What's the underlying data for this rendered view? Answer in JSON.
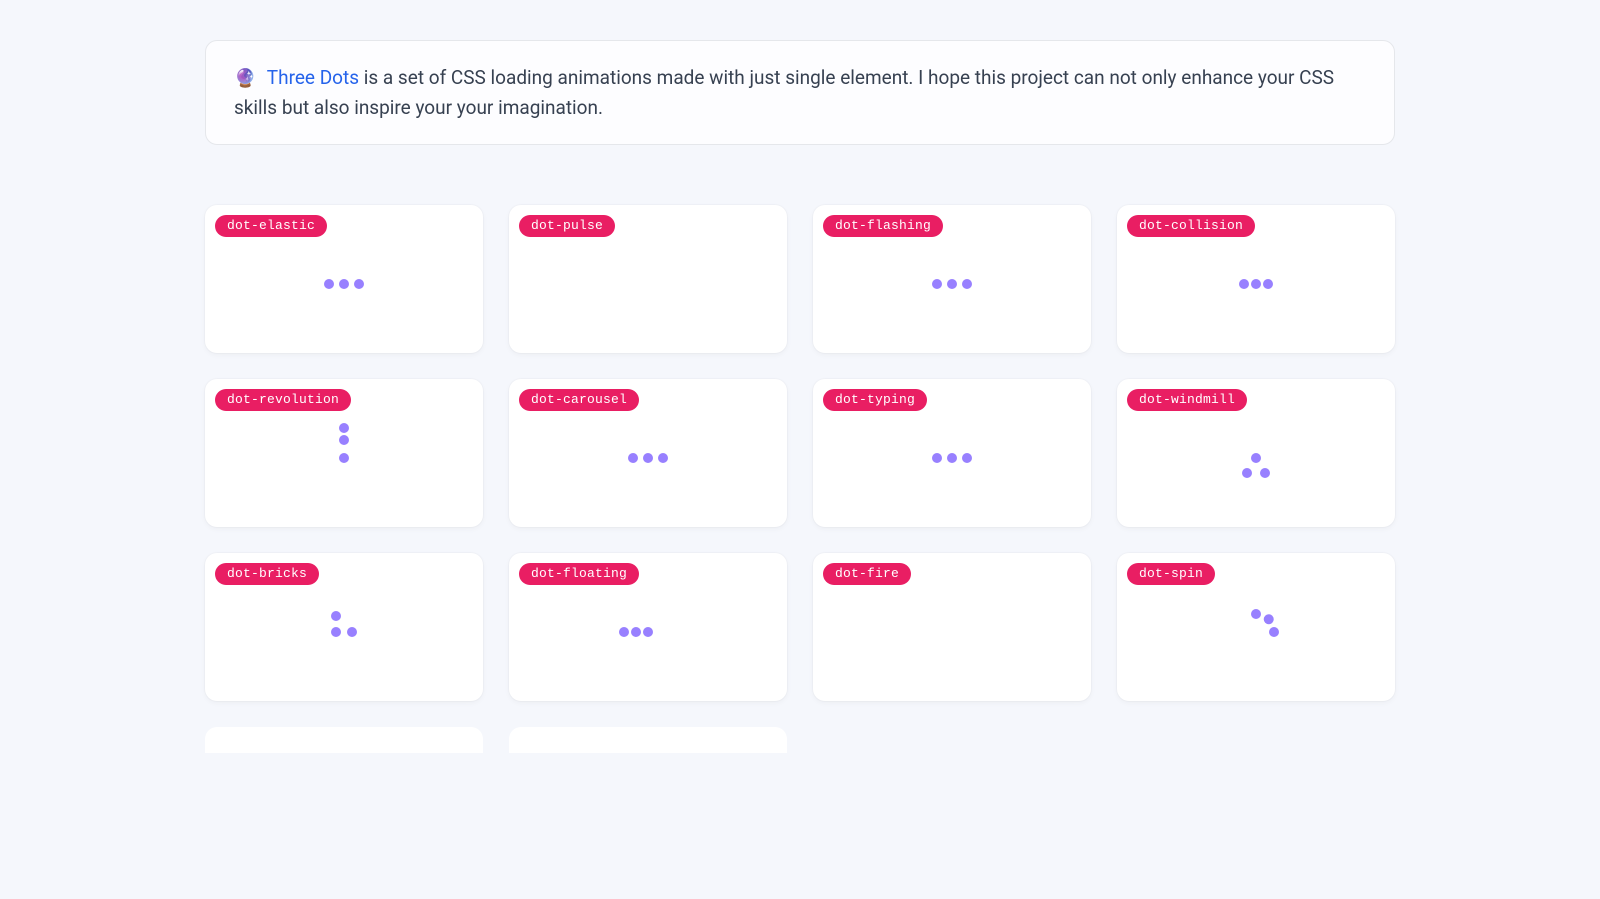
{
  "intro": {
    "emoji": "🔮",
    "link_text": "Three Dots",
    "desc": " is a set of CSS loading animations made with just single element. I hope this project can not only enhance your CSS skills but also inspire your your imagination."
  },
  "cards": [
    {
      "label": "dot-elastic",
      "anim": "dot-elastic"
    },
    {
      "label": "dot-pulse",
      "anim": "dot-pulse"
    },
    {
      "label": "dot-flashing",
      "anim": "dot-flashing"
    },
    {
      "label": "dot-collision",
      "anim": "dot-collision"
    },
    {
      "label": "dot-revolution",
      "anim": "dot-revolution"
    },
    {
      "label": "dot-carousel",
      "anim": "dot-carousel"
    },
    {
      "label": "dot-typing",
      "anim": "dot-typing"
    },
    {
      "label": "dot-windmill",
      "anim": "dot-windmill"
    },
    {
      "label": "dot-bricks",
      "anim": "dot-bricks"
    },
    {
      "label": "dot-floating",
      "anim": "dot-floating"
    },
    {
      "label": "dot-fire",
      "anim": "dot-fire"
    },
    {
      "label": "dot-spin",
      "anim": "dot-spin"
    }
  ],
  "colors": {
    "dot": "#9880ff",
    "pill": "#e91e63",
    "bg": "#f5f7fc"
  }
}
